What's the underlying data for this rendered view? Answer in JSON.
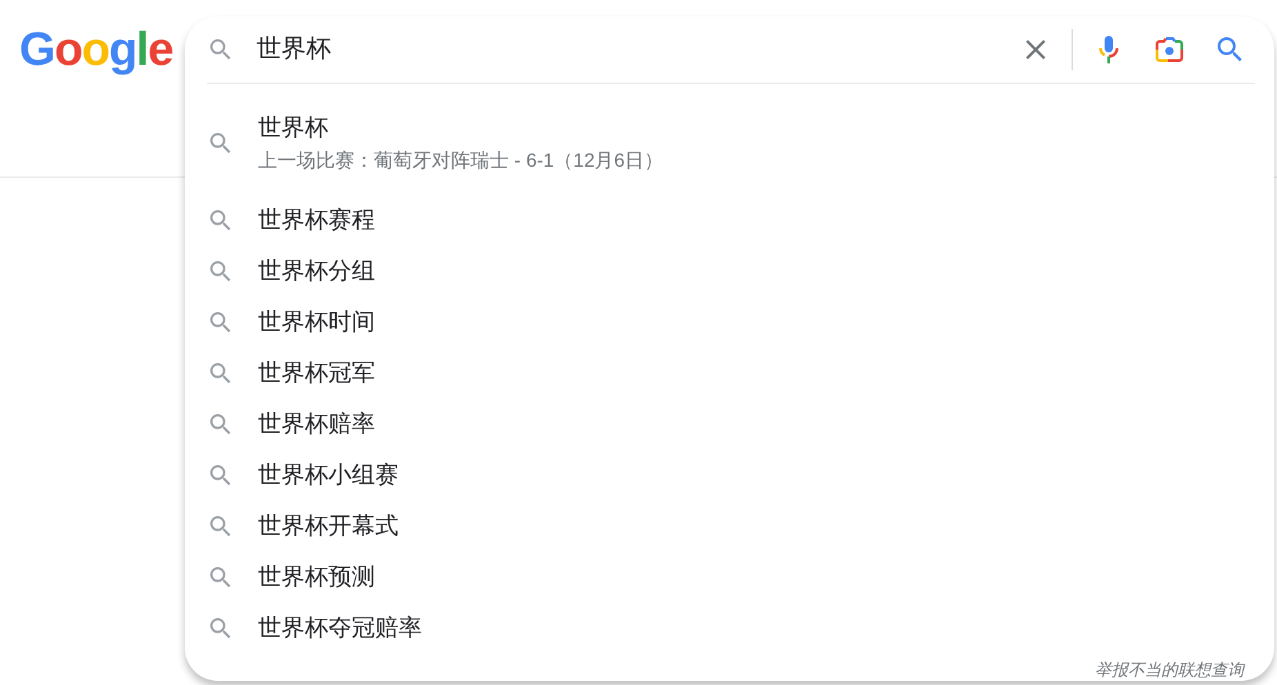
{
  "logo": {
    "text": "Google"
  },
  "search": {
    "value": "世界杯"
  },
  "suggestions": [
    {
      "text": "世界杯",
      "subtitle": "上一场比赛：葡萄牙对阵瑞士 - 6-1（12月6日）"
    },
    {
      "text": "世界杯赛程"
    },
    {
      "text": "世界杯分组"
    },
    {
      "text": "世界杯时间"
    },
    {
      "text": "世界杯冠军"
    },
    {
      "text": "世界杯赔率"
    },
    {
      "text": "世界杯小组赛"
    },
    {
      "text": "世界杯开幕式"
    },
    {
      "text": "世界杯预测"
    },
    {
      "text": "世界杯夺冠赔率"
    }
  ],
  "report_link": "举报不当的联想查询"
}
